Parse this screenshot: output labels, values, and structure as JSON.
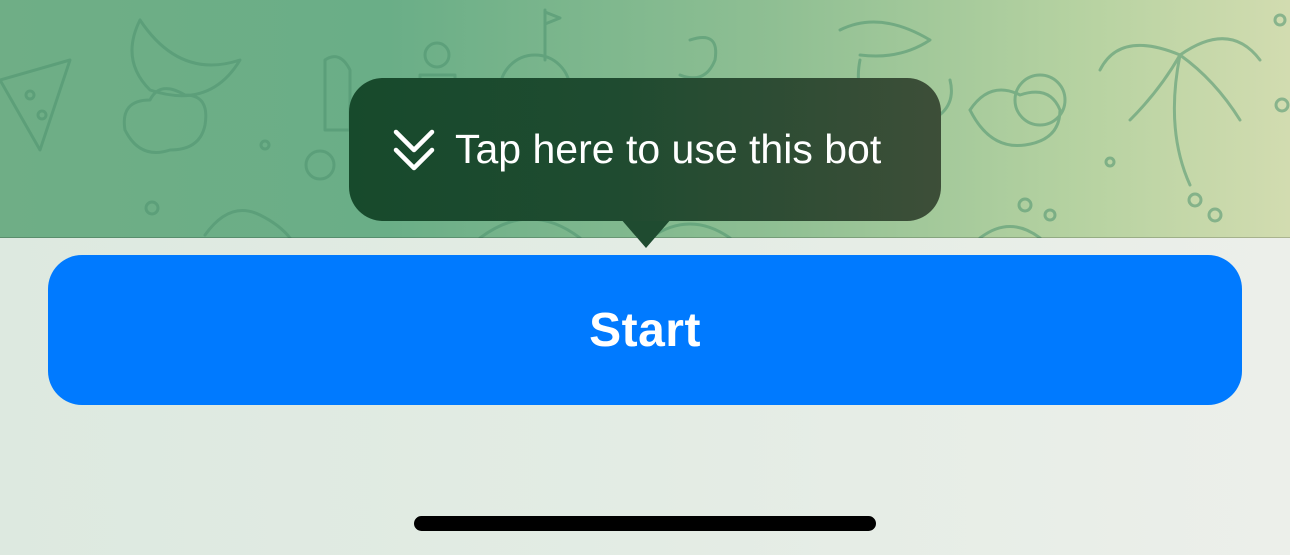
{
  "tooltip": {
    "text": "Tap here to use this bot",
    "icon": "double-chevron-down-icon"
  },
  "start_button": {
    "label": "Start"
  },
  "colors": {
    "button_blue": "#007aff",
    "tooltip_dark_green": "#1f4b30",
    "wallpaper_green": "#6fae86",
    "panel_background": "#e3ece4"
  }
}
